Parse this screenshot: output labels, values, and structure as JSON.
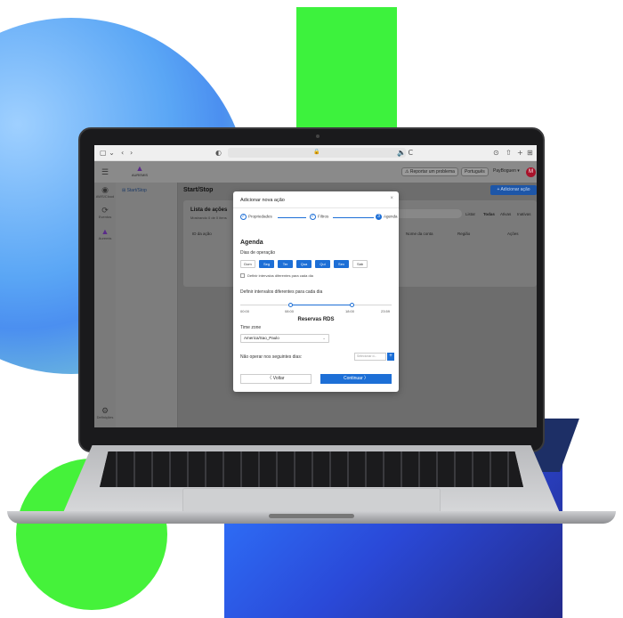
{
  "browser": {
    "url": "🔒",
    "refresh_label": "🔈 C"
  },
  "app": {
    "logo_text": "AUREMIS",
    "report_label": "Reportar um problema",
    "language_label": "Português",
    "user_label": "PayBoguen ▾",
    "avatar_initial": "M"
  },
  "rail": [
    {
      "icon": "☰",
      "label": ""
    },
    {
      "icon": "◉",
      "label": "AWS/Cloud"
    },
    {
      "icon": "⟳",
      "label": "Eventos"
    },
    {
      "icon": "▲",
      "label": "Auremis"
    },
    {
      "icon": "⚙",
      "label": "Definições"
    }
  ],
  "sidepanel": {
    "item": "⊞ Start/Stop"
  },
  "page": {
    "title": "Start/Stop",
    "add_action": "+ Adicionar ação",
    "list_title": "Lista de ações",
    "list_subtitle": "Mostrando 0 de 0 itens",
    "filter_label": "Listar",
    "filter_all": "Todas",
    "filter_active": "Ativas",
    "filter_inactive": "Inativas",
    "columns": [
      "ID da ação",
      "Nome da conta",
      "Região",
      "Ações"
    ]
  },
  "modal": {
    "title": "Adicionar nova ação",
    "close": "×",
    "steps": [
      "Propriedades",
      "Filtros",
      "Agenda"
    ],
    "section_title": "Agenda",
    "days_label": "Dias de operação",
    "days": [
      {
        "label": "Dom",
        "on": false
      },
      {
        "label": "Seg",
        "on": true
      },
      {
        "label": "Ter",
        "on": true
      },
      {
        "label": "Qua",
        "on": true
      },
      {
        "label": "Qui",
        "on": true
      },
      {
        "label": "Sex",
        "on": true
      },
      {
        "label": "Sáb",
        "on": false
      }
    ],
    "different_intervals_checkbox": "Definir intervalos diferentes para cada dia",
    "intervals_label": "Definir intervalos diferentes para cada dia",
    "slider_ticks": [
      "00:00",
      "08:00",
      "18:00",
      "23:59"
    ],
    "slider_range": [
      "08:00",
      "18:00"
    ],
    "rds_title": "Reservas RDS",
    "timezone_label": "Time zone",
    "timezone_value": "America/Sao_Paulo",
    "no_operate_label": "Não operar nos seguintes dias:",
    "date_placeholder": "Selecionar d...",
    "date_add": "+",
    "back_button": "〈  Voltar",
    "next_button": "Continuar  〉"
  }
}
